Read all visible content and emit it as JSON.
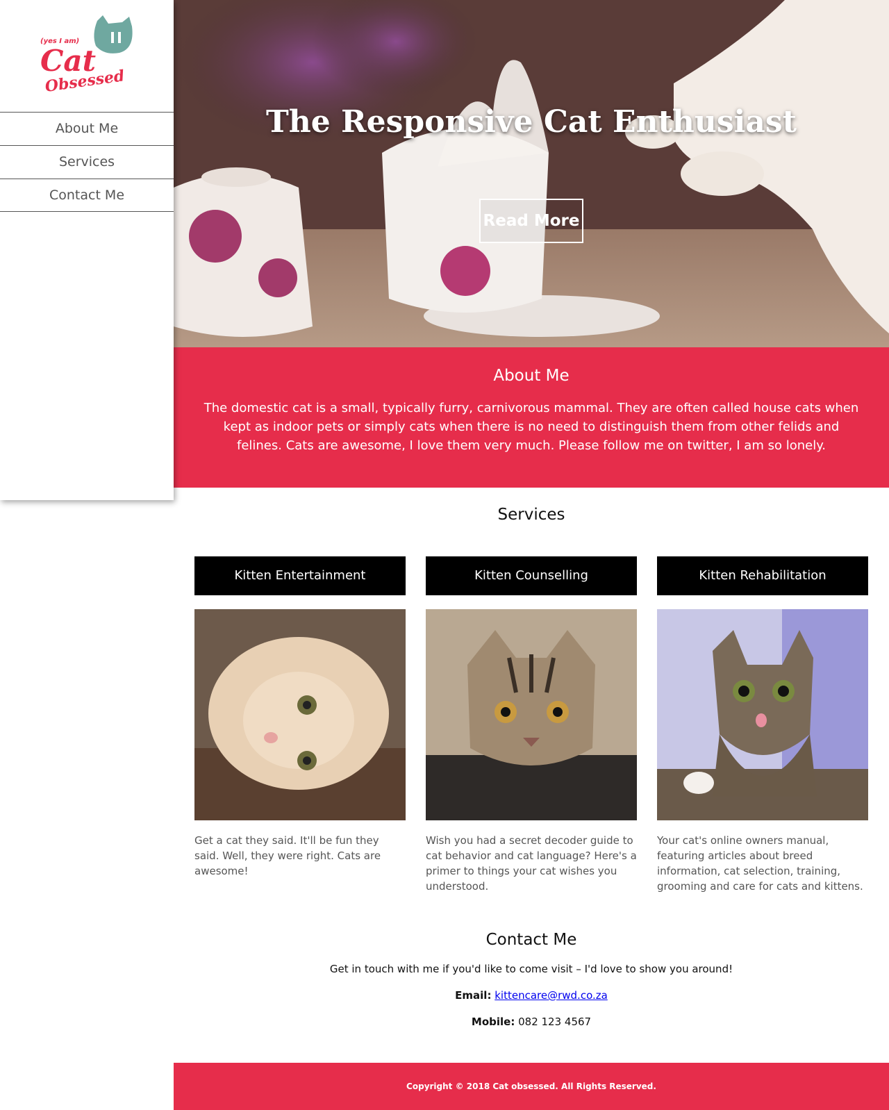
{
  "logo": {
    "tagline": "(yes I am)",
    "word1": "Cat",
    "word2": "Obsessed",
    "colors": {
      "red": "#e62d4b",
      "teal": "#6fa8a0"
    }
  },
  "nav": {
    "items": [
      {
        "label": "About Me"
      },
      {
        "label": "Services"
      },
      {
        "label": "Contact Me"
      }
    ]
  },
  "hero": {
    "title": "The Responsive Cat Enthusiast",
    "button_label": "Read More"
  },
  "about": {
    "heading": "About Me",
    "body": "The domestic cat is a small, typically furry, carnivorous mammal. They are often called house cats when kept as indoor pets or simply cats when there is no need to distinguish them from other felids and felines. Cats are awesome, I love them very much. Please follow me on twitter, I am so lonely."
  },
  "services": {
    "heading": "Services",
    "items": [
      {
        "title": "Kitten Entertainment",
        "description": "Get a cat they said. It'll be fun they said. Well, they were right. Cats are awesome!",
        "image_icon": "kitten-photo-icon"
      },
      {
        "title": "Kitten Counselling",
        "description": "Wish you had a secret decoder guide to cat behavior and cat language? Here's a primer to things your cat wishes you understood.",
        "image_icon": "kitten-photo-icon"
      },
      {
        "title": "Kitten Rehabilitation",
        "description": "Your cat's online owners manual, featuring articles about breed information, cat selection, training, grooming and care for cats and kittens.",
        "image_icon": "kitten-photo-icon"
      }
    ]
  },
  "contact": {
    "heading": "Contact Me",
    "lead": "Get in touch with me if you'd like to come visit – I'd love to show you around!",
    "email_label": "Email:",
    "email": "kittencare@rwd.co.za",
    "mobile_label": "Mobile:",
    "mobile": "082 123 4567"
  },
  "footer": {
    "copyright": "Copyright © 2018 Cat obsessed. All Rights Reserved."
  },
  "colors": {
    "accent": "#e62d4b",
    "service_header": "#000000",
    "link": "#0000ee"
  }
}
